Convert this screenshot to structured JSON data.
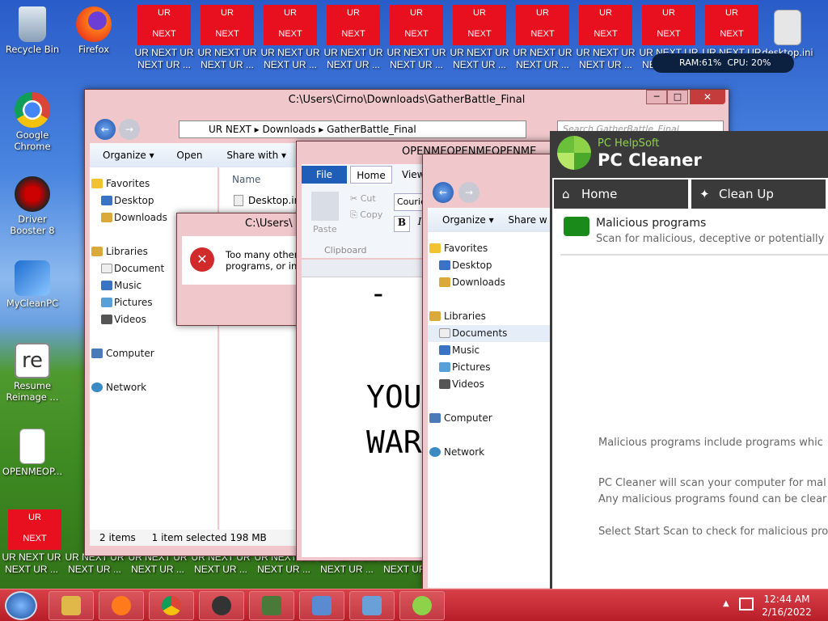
{
  "desktop": {
    "icons": [
      {
        "label": "Recycle Bin",
        "icon": "recycle-bin-icon"
      },
      {
        "label": "Firefox",
        "icon": "firefox-icon"
      },
      {
        "label": "Google Chrome",
        "icon": "chrome-icon"
      },
      {
        "label": "Driver Booster 8",
        "icon": "driver-booster-icon"
      },
      {
        "label": "MyCleanPC",
        "icon": "mycleanpc-icon"
      },
      {
        "label": "Resume Reimage ...",
        "icon": "reimage-icon"
      },
      {
        "label": "OPENMEOP...",
        "icon": "document-icon"
      },
      {
        "label": "desktop.ini",
        "icon": "settings-file-icon"
      }
    ],
    "ur_top": "UR",
    "ur_bottom": "NEXT",
    "ur_label_line1": "UR NEXT UR",
    "ur_label_line2": "NEXT UR ...",
    "ur_partial_1": "UR",
    "ur_partial_2": "NE"
  },
  "monitor": {
    "ram": "RAM:61%",
    "cpu": "CPU: 20%"
  },
  "explorer": {
    "title": "C:\\Users\\Cirno\\Downloads\\GatherBattle_Final",
    "breadcrumb": [
      "UR NEXT",
      "Downloads",
      "GatherBattle_Final"
    ],
    "search_placeholder": "Search GatherBattle_Final",
    "toolbar": [
      "Organize",
      "Open",
      "Share with"
    ],
    "nav": {
      "favorites": "Favorites",
      "desktop": "Desktop",
      "downloads": "Downloads",
      "libraries": "Libraries",
      "documents": "Document",
      "music": "Music",
      "pictures": "Pictures",
      "videos": "Videos",
      "computer": "Computer",
      "network": "Network"
    },
    "column_name": "Name",
    "file": "Desktop.ini",
    "status_items": "2 items",
    "status_selected": "1 item selected  198 MB"
  },
  "error_dialog": {
    "title": "C:\\Users\\",
    "message_line1": "Too many other",
    "message_line2": "programs, or inc"
  },
  "wordpad": {
    "title": "OPENMEOPENMEOPENME",
    "tabs": [
      "File",
      "Home",
      "View"
    ],
    "cut": "Cut",
    "copy": "Copy",
    "paste": "Paste",
    "clipboard": "Clipboard",
    "font": "Courie",
    "bold": "B",
    "italic": "I",
    "doc_line1": "YOU",
    "doc_line2": "WAR",
    "doc_dash": "-"
  },
  "explorer2": {
    "toolbar": [
      "Organize",
      "Share w"
    ],
    "nav": {
      "favorites": "Favorites",
      "desktop": "Desktop",
      "downloads": "Downloads",
      "libraries": "Libraries",
      "documents": "Documents",
      "music": "Music",
      "pictures": "Pictures",
      "videos": "Videos",
      "computer": "Computer",
      "network": "Network"
    }
  },
  "pccleaner": {
    "brand_small": "PC HelpSoft",
    "brand_big": "PC Cleaner",
    "tab_home": "Home",
    "tab_cleanup": "Clean Up",
    "section_title": "Malicious programs",
    "section_sub": "Scan for malicious, deceptive or potentially",
    "p1": "Malicious programs include programs whic",
    "p2a": "PC Cleaner will scan your computer for mal",
    "p2b": "Any malicious programs found can be clear",
    "p3": "Select Start Scan to check for malicious pro"
  },
  "taskbar": {
    "time": "12:44 AM",
    "date": "2/16/2022"
  },
  "colors": {
    "accent": "#e8101e",
    "taskbar": "#c8303a",
    "cleaner_dark": "#3a3a3a"
  }
}
